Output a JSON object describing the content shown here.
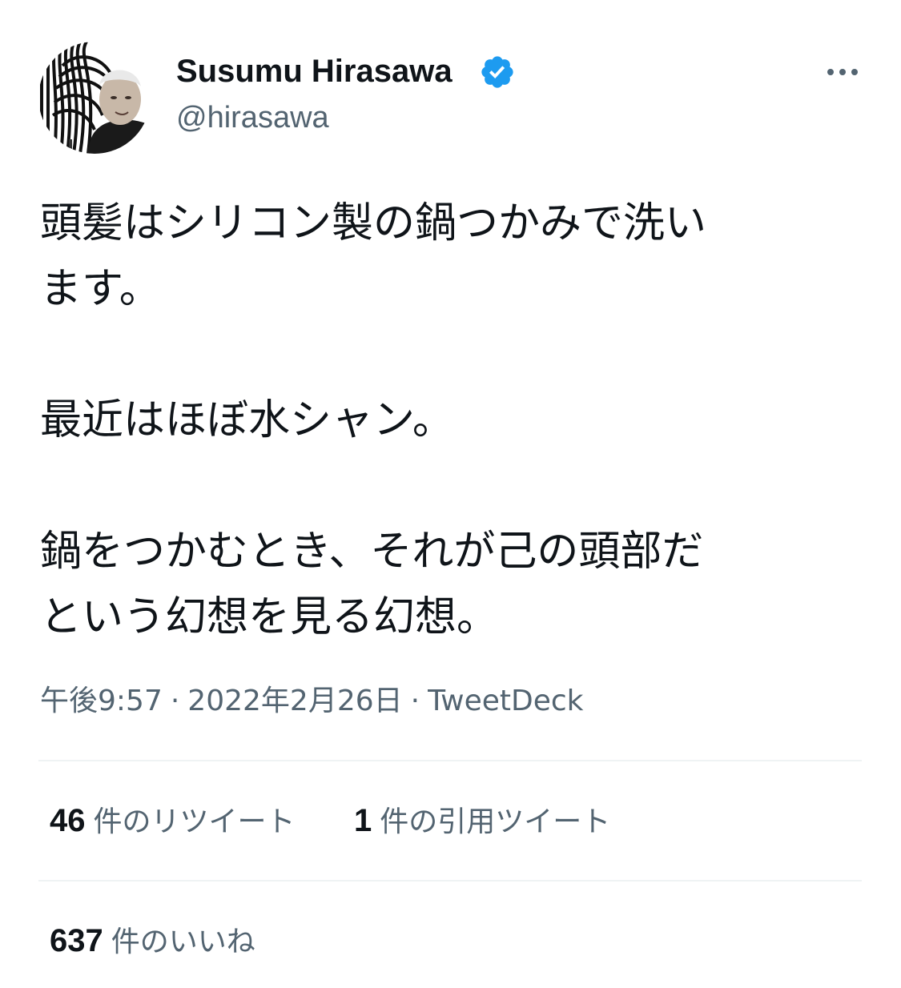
{
  "author": {
    "display_name": "Susumu Hirasawa",
    "handle": "@hirasawa",
    "verified": true,
    "accent_color": "#1d9bf0"
  },
  "icons": {
    "verified": "verified-badge-icon",
    "more": "more-options-icon"
  },
  "tweet": {
    "paragraph1_line1": "頭髪はシリコン製の鍋つかみで洗い",
    "paragraph1_line2": "ます。",
    "paragraph2": "最近はほぼ水シャン。",
    "paragraph3_line1": "鍋をつかむとき、それが己の頭部だ",
    "paragraph3_line2": "という幻想を見る幻想。"
  },
  "meta": {
    "time": "午後9:57",
    "separator": "·",
    "date": "2022年2月26日",
    "source": "TweetDeck"
  },
  "stats": {
    "retweets": {
      "count": "46",
      "label": "件のリツイート"
    },
    "quotes": {
      "count": "1",
      "label": "件の引用ツイート"
    },
    "likes": {
      "count": "637",
      "label": "件のいいね"
    }
  },
  "colors": {
    "text": "#0f1419",
    "secondary": "#536471",
    "divider": "#eff3f4"
  }
}
